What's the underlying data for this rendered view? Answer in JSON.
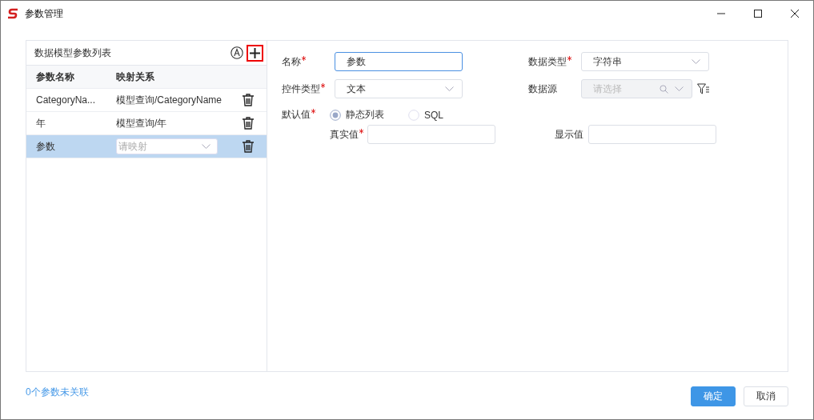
{
  "window": {
    "title": "参数管理"
  },
  "param_list": {
    "title": "数据模型参数列表",
    "columns": [
      "参数名称",
      "映射关系"
    ],
    "rows": [
      {
        "name": "CategoryNa...",
        "mapping": {
          "kind": "text",
          "value": "模型查询/CategoryName"
        },
        "selected": false
      },
      {
        "name": "年",
        "mapping": {
          "kind": "text",
          "value": "模型查询/年"
        },
        "selected": false
      },
      {
        "name": "参数",
        "mapping": {
          "kind": "select",
          "placeholder": "请映射"
        },
        "selected": true
      }
    ]
  },
  "form": {
    "name": {
      "label": "名称",
      "required": true,
      "value": "参数",
      "focused": true
    },
    "data_type": {
      "label": "数据类型",
      "required": true,
      "value": "字符串"
    },
    "control_type": {
      "label": "控件类型",
      "required": true,
      "value": "文本"
    },
    "data_source": {
      "label": "数据源",
      "required": false,
      "placeholder": "请选择",
      "disabled": true
    },
    "default_value": {
      "label": "默认值",
      "required": true,
      "options": [
        {
          "label": "静态列表",
          "selected": true
        },
        {
          "label": "SQL",
          "selected": false
        }
      ]
    },
    "real_value": {
      "label": "真实值",
      "required": true
    },
    "display_value": {
      "label": "显示值",
      "required": false
    }
  },
  "footer": {
    "link": "0个参数未关联",
    "buttons": [
      {
        "label": "确定",
        "kind": "primary"
      },
      {
        "label": "取消",
        "kind": "default"
      }
    ]
  }
}
